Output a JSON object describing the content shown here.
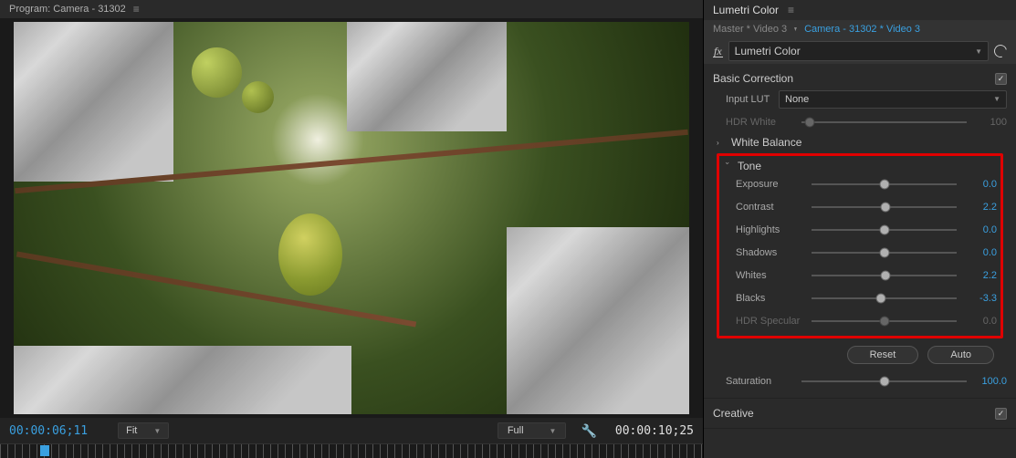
{
  "program": {
    "title": "Program: Camera - 31302",
    "tc_left": "00:00:06;11",
    "fit_label": "Fit",
    "zoom_label": "Full",
    "tc_right": "00:00:10;25"
  },
  "lumetri": {
    "panel_title": "Lumetri Color",
    "breadcrumb": {
      "master": "Master * Video 3",
      "clip": "Camera - 31302 * Video 3"
    },
    "fx_name": "Lumetri Color",
    "sections": {
      "basic_correction": {
        "title": "Basic Correction",
        "checked": true,
        "input_lut_label": "Input LUT",
        "input_lut_value": "None",
        "hdr_white": {
          "label": "HDR White",
          "value": "100",
          "pos": 5
        },
        "white_balance_title": "White Balance",
        "tone_title": "Tone",
        "tone": {
          "exposure": {
            "label": "Exposure",
            "value": "0.0",
            "pos": 50
          },
          "contrast": {
            "label": "Contrast",
            "value": "2.2",
            "pos": 51
          },
          "highlights": {
            "label": "Highlights",
            "value": "0.0",
            "pos": 50
          },
          "shadows": {
            "label": "Shadows",
            "value": "0.0",
            "pos": 50
          },
          "whites": {
            "label": "Whites",
            "value": "2.2",
            "pos": 51
          },
          "blacks": {
            "label": "Blacks",
            "value": "-3.3",
            "pos": 48
          },
          "hdr_specular": {
            "label": "HDR Specular",
            "value": "0.0",
            "pos": 50
          }
        },
        "reset_btn": "Reset",
        "auto_btn": "Auto",
        "saturation": {
          "label": "Saturation",
          "value": "100.0",
          "pos": 50
        }
      },
      "creative_title": "Creative",
      "creative_checked": true
    }
  }
}
